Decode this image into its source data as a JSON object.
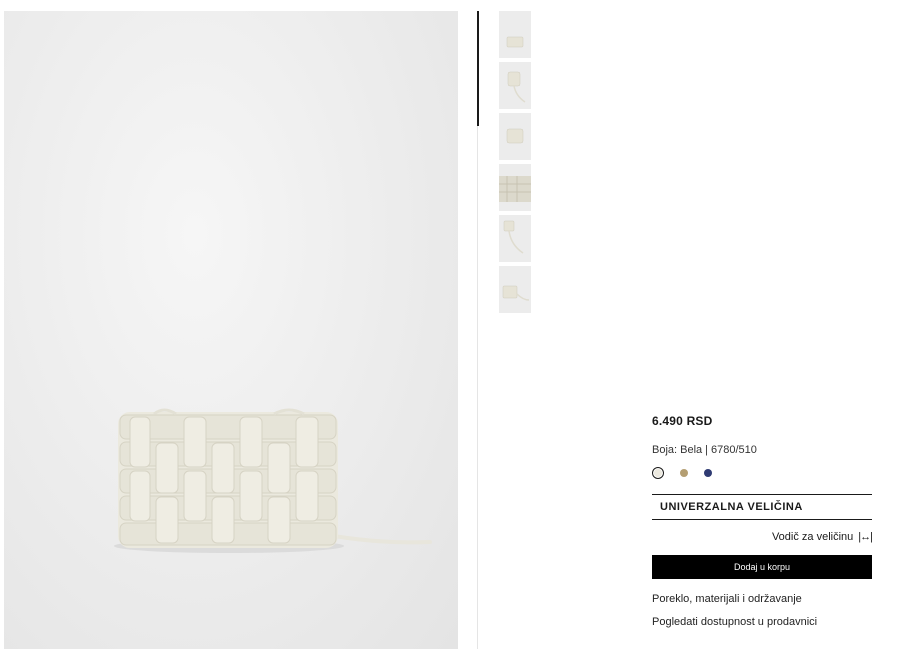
{
  "product": {
    "price": "6.490 RSD",
    "color_label": "Boja: Bela",
    "color_separator": "|",
    "reference": "6780/510",
    "swatches": [
      {
        "name": "Bela",
        "color": "#ece9df",
        "selected": true
      },
      {
        "name": "Bež",
        "color": "#b49e72",
        "selected": false
      },
      {
        "name": "Plava",
        "color": "#2f3b73",
        "selected": false
      }
    ],
    "size_label": "UNIVERZALNA VELIČINA",
    "size_guide_label": "Vodič za veličinu",
    "size_guide_icon": "|↔|",
    "add_to_cart_label": "Dodaj u korpu",
    "links": {
      "origin": "Poreklo, materijali i održavanje",
      "availability": "Pogledati dostupnost u prodavnici"
    }
  },
  "gallery": {
    "thumbnail_count": 6,
    "active_thumbnail": 1,
    "main_image_subject": "woven-bag-image"
  }
}
